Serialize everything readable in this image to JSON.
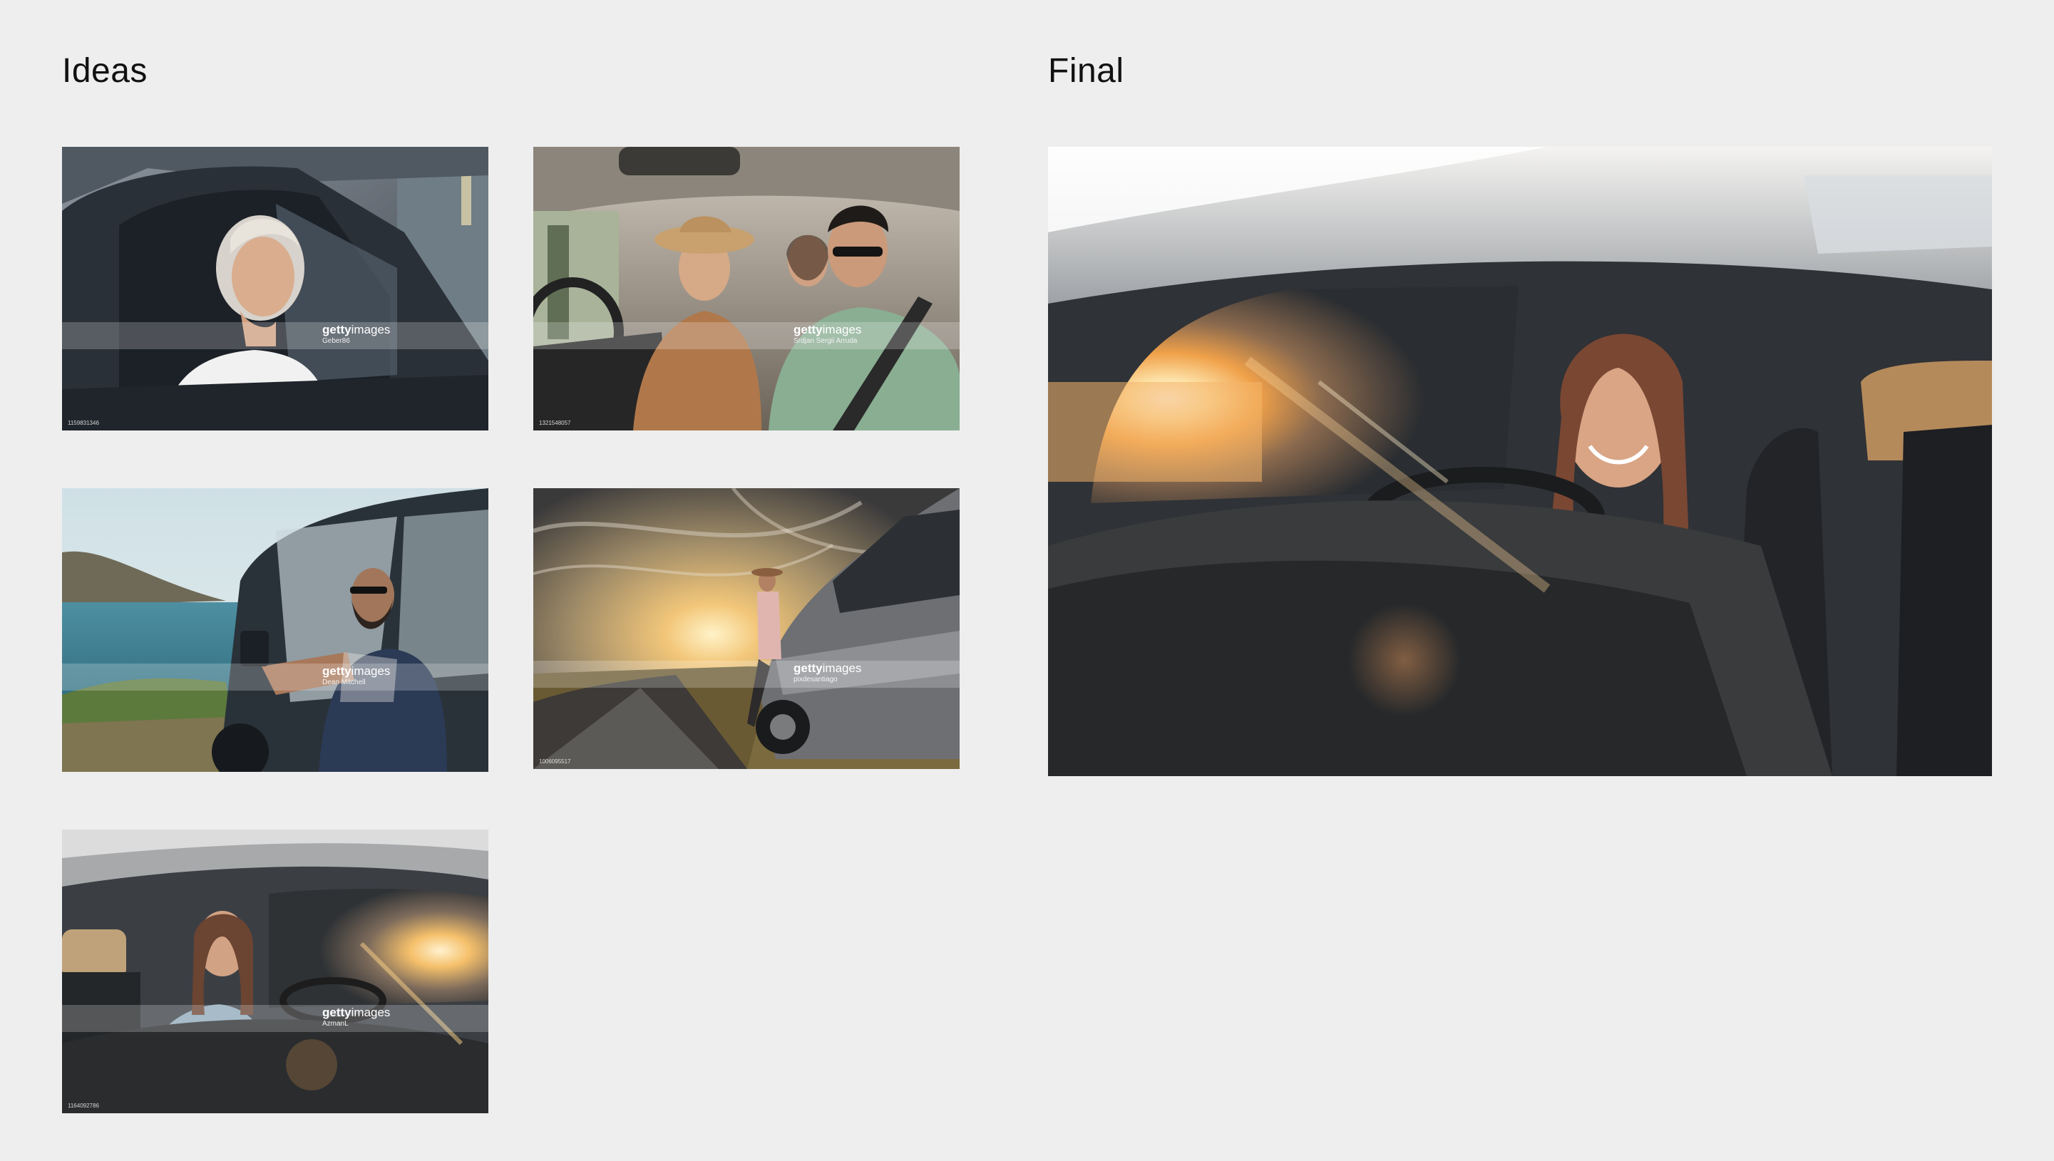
{
  "headings": {
    "ideas": "Ideas",
    "final": "Final"
  },
  "ideas": [
    {
      "scene": "smiling woman with blonde hair in driver seat of dark car",
      "brand_bold": "getty",
      "brand_light": "images",
      "credit": "Geber86",
      "stock_id": "1159831346"
    },
    {
      "scene": "three friends laughing in car, woman in hat driving",
      "brand_bold": "getty",
      "brand_light": "images",
      "credit": "Srdjan Sergii Arruda",
      "stock_id": "1321548057"
    },
    {
      "scene": "man with sunglasses leaning out of dark car window by the sea",
      "brand_bold": "getty",
      "brand_light": "images",
      "credit": "Dean Mitchell",
      "stock_id": ""
    },
    {
      "scene": "woman sitting on car at sunset on country road",
      "brand_bold": "getty",
      "brand_light": "images",
      "credit": "pixdesantiago",
      "stock_id": "1006095517"
    },
    {
      "scene": "smiling woman driving car with golden sun flare",
      "brand_bold": "getty",
      "brand_light": "images",
      "credit": "AzmanL",
      "stock_id": "1164092786"
    }
  ],
  "final": {
    "scene": "smiling woman driving car with golden sun flare (large)"
  },
  "colors": {
    "background": "#eeeeee",
    "heading": "#111111"
  }
}
